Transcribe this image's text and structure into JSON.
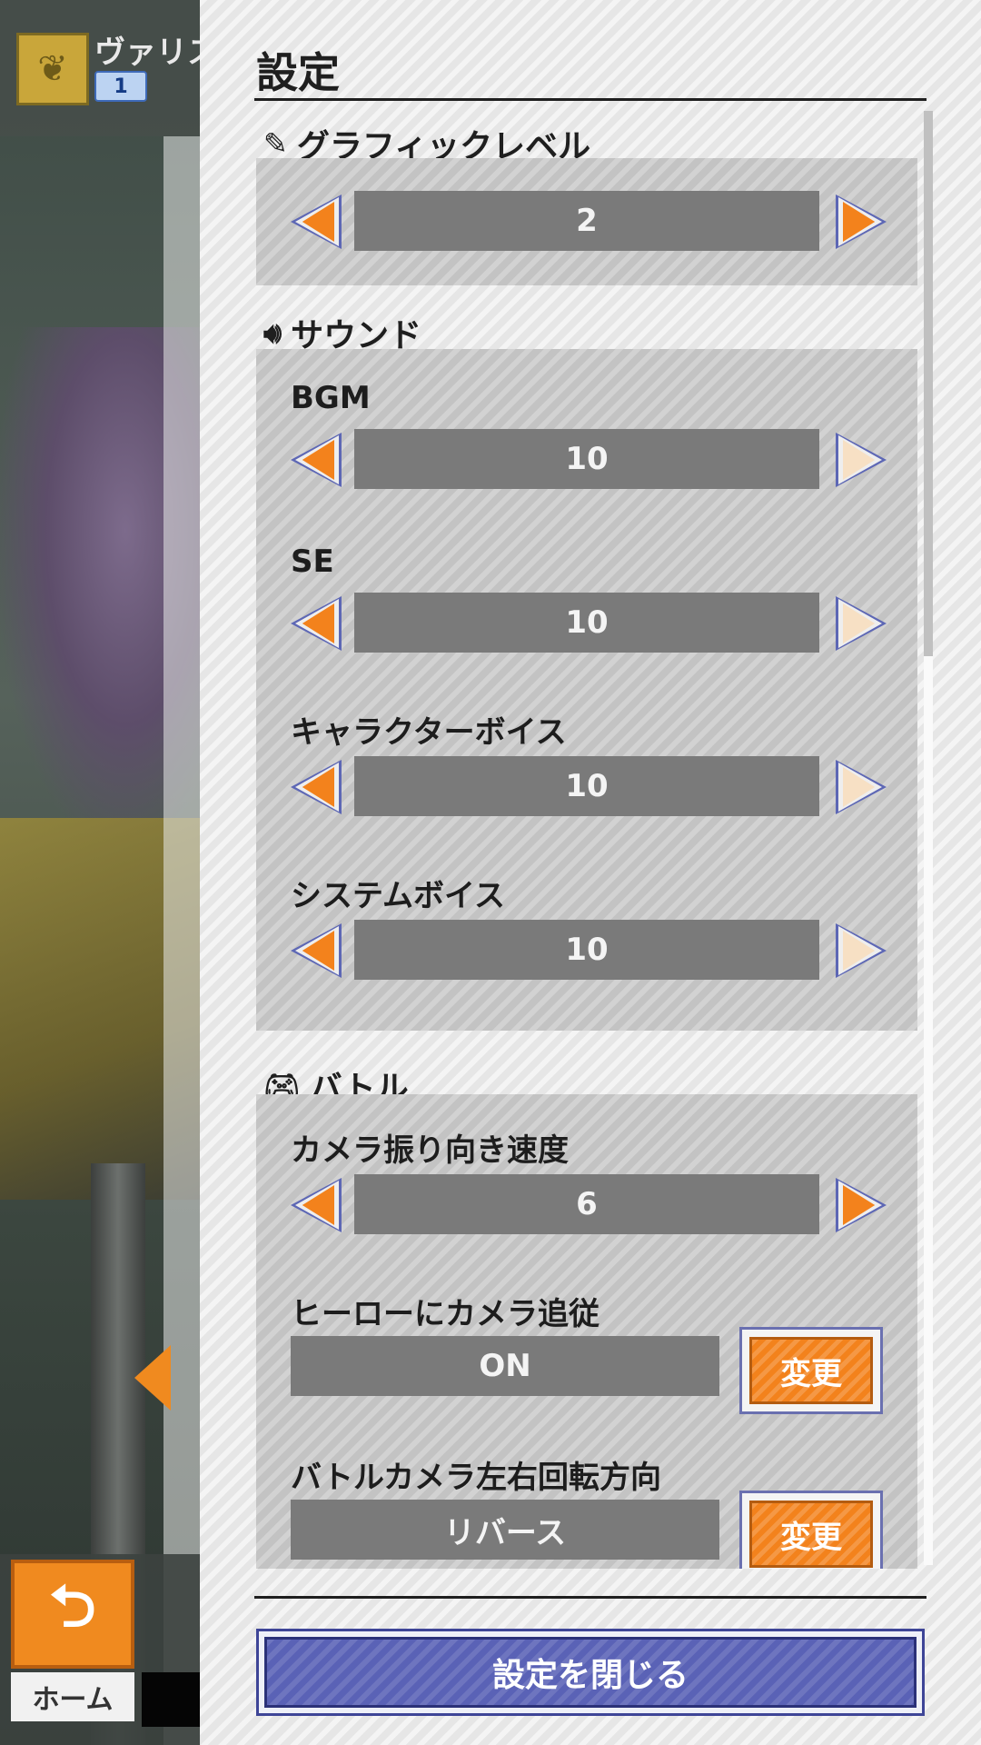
{
  "header": {
    "player_name": "ヴァリス",
    "rank": "1"
  },
  "bottom_nav": {
    "home_label": "ホーム",
    "home_icon": "back-arrow-icon"
  },
  "settings": {
    "title": "設定",
    "sections": {
      "graphics": {
        "heading": "グラフィックレベル",
        "icon": "pencil-icon",
        "level": "2"
      },
      "sound": {
        "heading": "サウンド",
        "icon": "speaker-icon",
        "bgm": {
          "label": "BGM",
          "value": "10"
        },
        "se": {
          "label": "SE",
          "value": "10"
        },
        "character_voice": {
          "label": "キャラクターボイス",
          "value": "10"
        },
        "system_voice": {
          "label": "システムボイス",
          "value": "10"
        }
      },
      "battle": {
        "heading": "バトル",
        "icon": "gamepad-icon",
        "camera_speed": {
          "label": "カメラ振り向き速度",
          "value": "6"
        },
        "camera_follow": {
          "label": "ヒーローにカメラ追従",
          "value": "ON",
          "button": "変更"
        },
        "camera_rotation": {
          "label": "バトルカメラ左右回転方向",
          "value": "リバース",
          "button": "変更"
        }
      }
    },
    "close_button": "設定を閉じる"
  },
  "colors": {
    "accent_orange": "#f3821c",
    "button_blue": "#5a62b6",
    "value_gray": "#7a7a7a"
  }
}
